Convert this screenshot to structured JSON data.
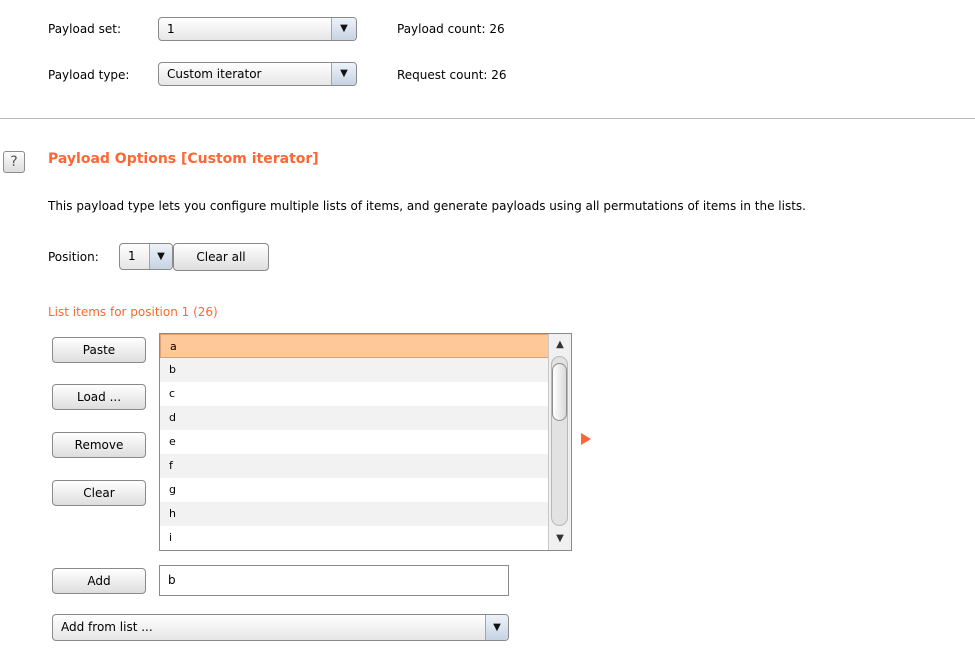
{
  "payload_set": {
    "label": "Payload set:",
    "value": "1"
  },
  "payload_type": {
    "label": "Payload type:",
    "value": "Custom iterator"
  },
  "payload_count": "Payload count: 26",
  "request_count": "Request count: 26",
  "help_icon": "?",
  "section": {
    "title": "Payload Options [Custom iterator]",
    "description": "This payload type lets you configure multiple lists of items, and generate payloads using all permutations of items in the lists."
  },
  "position": {
    "label": "Position:",
    "value": "1",
    "clear_all": "Clear all"
  },
  "list": {
    "caption": "List items for position 1 (26)",
    "items": [
      "a",
      "b",
      "c",
      "d",
      "e",
      "f",
      "g",
      "h",
      "i"
    ],
    "selected_index": 0
  },
  "buttons": {
    "paste": "Paste",
    "load": "Load ...",
    "remove": "Remove",
    "clear": "Clear",
    "add": "Add"
  },
  "add_input": {
    "value": "b"
  },
  "add_from_list": {
    "value": "Add from list ..."
  },
  "colors": {
    "accent": "#ff6633",
    "selection": "#ffc898"
  },
  "icons": {
    "dropdown": "triangle-down",
    "scroll_up": "triangle-up",
    "scroll_down": "triangle-down",
    "expand": "triangle-right"
  }
}
